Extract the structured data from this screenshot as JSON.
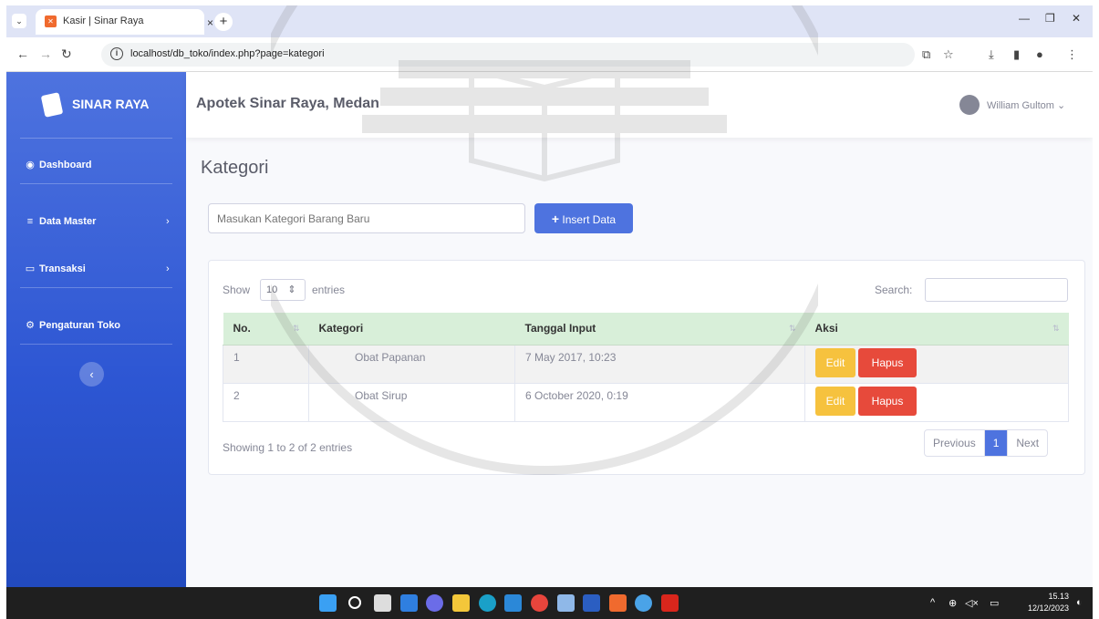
{
  "browser": {
    "tab_title": "Kasir | Sinar Raya",
    "tab_close": "×",
    "new_tab": "+",
    "url": "localhost/db_toko/index.php?page=kategori"
  },
  "sidebar": {
    "brand": "SINAR RAYA",
    "items": [
      {
        "label": "Dashboard",
        "icon": "tachometer-icon"
      },
      {
        "label": "Data Master",
        "icon": "database-icon"
      },
      {
        "label": "Transaksi",
        "icon": "desktop-icon"
      },
      {
        "label": "Pengaturan Toko",
        "icon": "cogs-icon"
      }
    ],
    "toggle": "‹"
  },
  "topbar": {
    "title": "Apotek Sinar Raya, Medan",
    "user": "William Gultom"
  },
  "page": {
    "title": "Kategori",
    "input_placeholder": "Masukan Kategori Barang Baru",
    "insert_label": "Insert Data"
  },
  "table": {
    "show_label": "Show",
    "entries_value": "10",
    "entries_label": "entries",
    "search_label": "Search:",
    "headers": {
      "no": "No.",
      "kategori": "Kategori",
      "tanggal": "Tanggal Input",
      "aksi": "Aksi"
    },
    "rows": [
      {
        "no": "1",
        "kategori": "Obat Papanan",
        "tanggal": "7 May 2017, 10:23"
      },
      {
        "no": "2",
        "kategori": "Obat Sirup",
        "tanggal": "6 October 2020, 0:19"
      }
    ],
    "edit_label": "Edit",
    "delete_label": "Hapus",
    "info": "Showing 1 to 2 of 2 entries",
    "pagination": {
      "previous": "Previous",
      "current": "1",
      "next": "Next"
    }
  },
  "taskbar": {
    "time": "15.13",
    "date": "12/12/2023"
  },
  "colors": {
    "primary": "#4e73df",
    "edit": "#f6c23e",
    "delete": "#e74a3b",
    "header_row": "#d8efd9"
  }
}
